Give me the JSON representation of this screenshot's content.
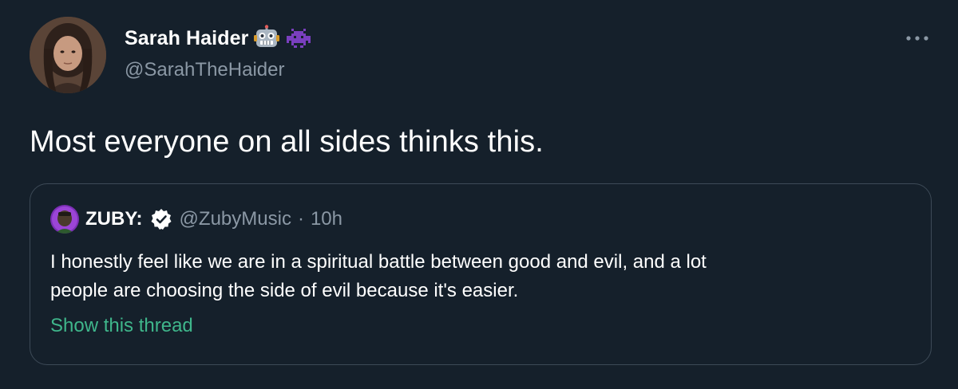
{
  "colors": {
    "background": "#15202b",
    "text_primary": "#ffffff",
    "text_secondary": "#8b98a5",
    "quote_border": "#3d4a57",
    "link": "#3fb68b"
  },
  "author": {
    "display_name": "Sarah Haider",
    "handle": "@SarahTheHaider",
    "name_emojis": [
      "robot-emoji-icon",
      "space-invader-emoji-icon"
    ]
  },
  "tweet": {
    "text": "Most everyone on all sides thinks this."
  },
  "quoted_tweet": {
    "display_name": "ZUBY:",
    "verified": true,
    "handle": "@ZubyMusic",
    "separator": "·",
    "time": "10h",
    "text_lines": [
      "I honestly feel like we are in a spiritual battle between good and evil, and a lot",
      "people are choosing the side of evil because it's easier."
    ],
    "show_thread_label": "Show this thread"
  },
  "icons": {
    "more": "more-options-icon",
    "verified": "verified-badge-icon"
  }
}
